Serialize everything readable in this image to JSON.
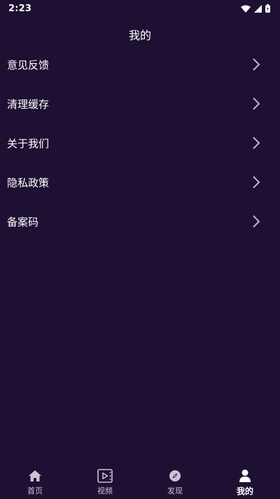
{
  "status_bar": {
    "time": "2:23",
    "icons": [
      "wifi-icon",
      "cellular-signal-icon",
      "battery-icon"
    ]
  },
  "header": {
    "title": "我的"
  },
  "menu": {
    "items": [
      {
        "label": "意见反馈"
      },
      {
        "label": "清理缓存"
      },
      {
        "label": "关于我们"
      },
      {
        "label": "隐私政策"
      },
      {
        "label": "备案码"
      }
    ]
  },
  "bottom_nav": {
    "tabs": [
      {
        "label": "首页",
        "icon": "home-icon",
        "active": false
      },
      {
        "label": "视频",
        "icon": "video-icon",
        "active": false
      },
      {
        "label": "发现",
        "icon": "compass-icon",
        "active": false
      },
      {
        "label": "我的",
        "icon": "user-icon",
        "active": true
      }
    ]
  },
  "colors": {
    "background": "#1e1033",
    "text": "#ffffff",
    "inactive_tab": "#c9c3d6",
    "chevron": "#bdb7c8"
  }
}
